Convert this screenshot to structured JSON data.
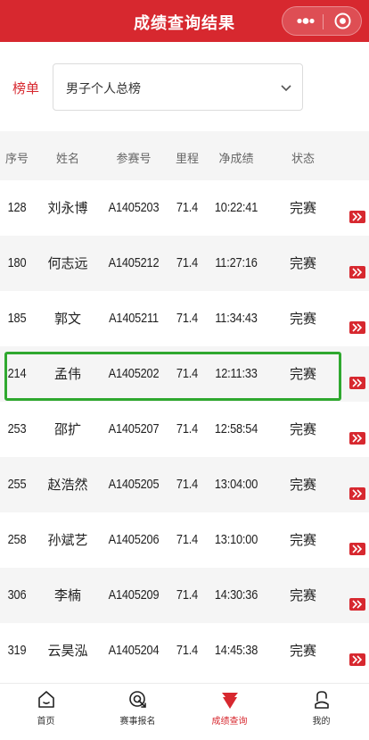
{
  "nav": {
    "title": "成绩查询结果"
  },
  "ranking": {
    "label": "榜单",
    "selected": "男子个人总榜"
  },
  "table": {
    "headers": {
      "no": "序号",
      "name": "姓名",
      "bib": "参赛号",
      "distance": "里程",
      "net_time": "净成绩",
      "status": "状态"
    },
    "rows": [
      {
        "no": "128",
        "name": "刘永博",
        "bib": "A1405203",
        "distance": "71.4",
        "net_time": "10:22:41",
        "status": "完赛"
      },
      {
        "no": "180",
        "name": "何志远",
        "bib": "A1405212",
        "distance": "71.4",
        "net_time": "11:27:16",
        "status": "完赛"
      },
      {
        "no": "185",
        "name": "郭文",
        "bib": "A1405211",
        "distance": "71.4",
        "net_time": "11:34:43",
        "status": "完赛"
      },
      {
        "no": "214",
        "name": "孟伟",
        "bib": "A1405202",
        "distance": "71.4",
        "net_time": "12:11:33",
        "status": "完赛"
      },
      {
        "no": "253",
        "name": "邵扩",
        "bib": "A1405207",
        "distance": "71.4",
        "net_time": "12:58:54",
        "status": "完赛"
      },
      {
        "no": "255",
        "name": "赵浩然",
        "bib": "A1405205",
        "distance": "71.4",
        "net_time": "13:04:00",
        "status": "完赛"
      },
      {
        "no": "258",
        "name": "孙斌艺",
        "bib": "A1405206",
        "distance": "71.4",
        "net_time": "13:10:00",
        "status": "完赛"
      },
      {
        "no": "306",
        "name": "李楠",
        "bib": "A1405209",
        "distance": "71.4",
        "net_time": "14:30:36",
        "status": "完赛"
      },
      {
        "no": "319",
        "name": "云昊泓",
        "bib": "A1405204",
        "distance": "71.4",
        "net_time": "14:45:38",
        "status": "完赛"
      }
    ],
    "highlighted_row_index": 3
  },
  "tabbar": {
    "tabs": [
      {
        "label": "首页",
        "icon": "home-icon"
      },
      {
        "label": "赛事报名",
        "icon": "signup-icon"
      },
      {
        "label": "成绩查询",
        "icon": "results-icon",
        "active": true
      },
      {
        "label": "我的",
        "icon": "profile-icon"
      }
    ]
  },
  "colors": {
    "brand": "#d7282f",
    "highlight": "#2fa82f",
    "row_alt": "#f5f5f5"
  }
}
